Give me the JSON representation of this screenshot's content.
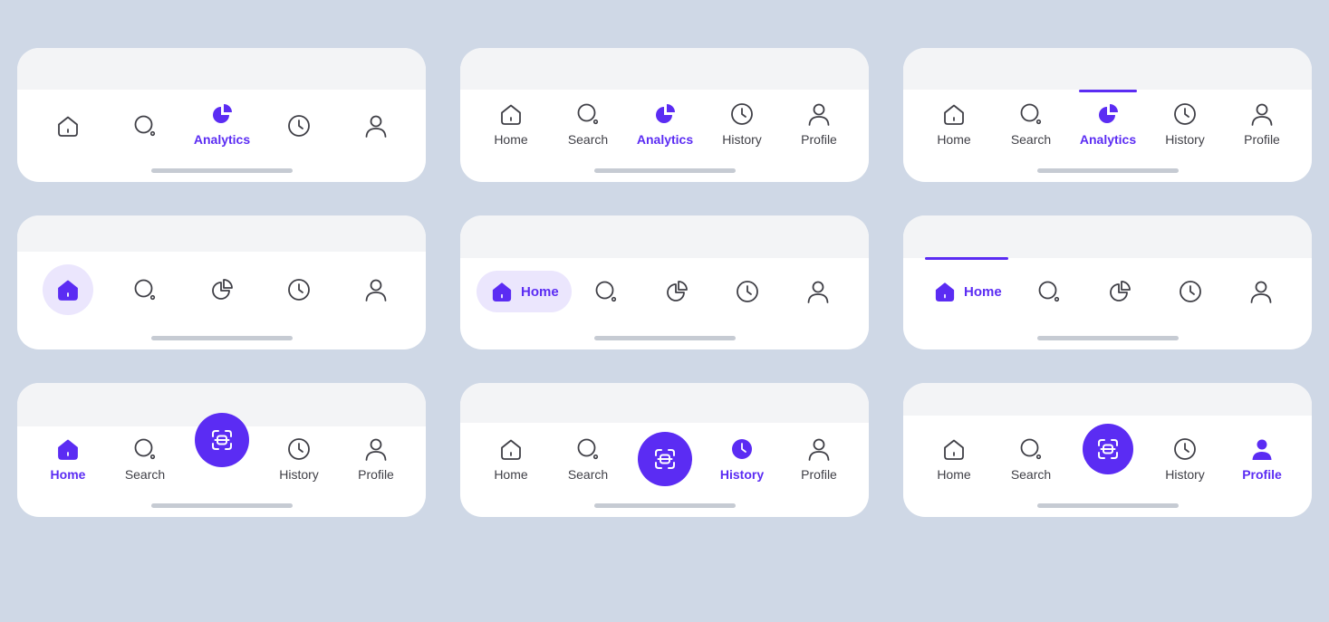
{
  "labels": {
    "home": "Home",
    "search": "Search",
    "analytics": "Analytics",
    "history": "History",
    "profile": "Profile"
  },
  "accent_color": "#5b2cf3",
  "icons": [
    "home-icon",
    "search-icon",
    "analytics-icon",
    "history-icon",
    "profile-icon",
    "scan-icon"
  ],
  "variants": [
    {
      "active": "analytics",
      "labels_shown": "active-only"
    },
    {
      "active": "analytics",
      "labels_shown": "all"
    },
    {
      "active": "analytics",
      "labels_shown": "all",
      "indicator": "top-line"
    },
    {
      "active": "home",
      "labels_shown": "none",
      "indicator": "circle"
    },
    {
      "active": "home",
      "labels_shown": "active-only",
      "indicator": "pill"
    },
    {
      "active": "home",
      "labels_shown": "active-only",
      "indicator": "top-line"
    },
    {
      "active": "home",
      "labels_shown": "all",
      "center": "scan-button"
    },
    {
      "active": "history",
      "labels_shown": "all",
      "center": "scan-button"
    },
    {
      "active": "profile",
      "labels_shown": "all",
      "center": "scan-button"
    }
  ]
}
